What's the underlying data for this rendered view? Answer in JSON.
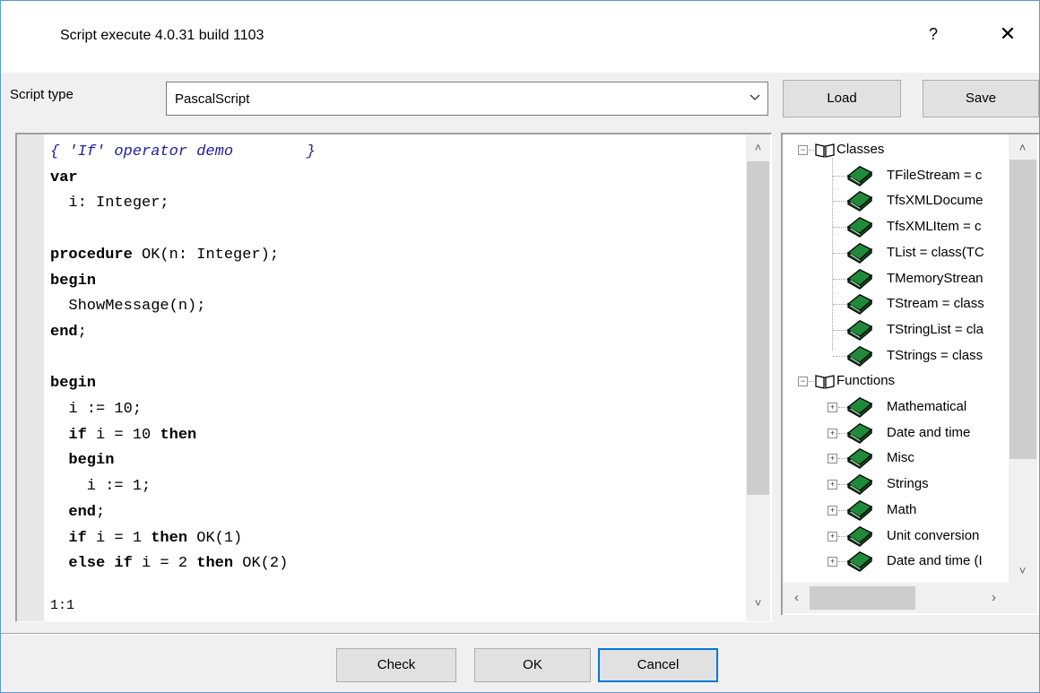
{
  "window": {
    "title": "Script execute 4.0.31 build 1103",
    "help_label": "?",
    "close_label": "✕"
  },
  "toolbar": {
    "script_type_label": "Script type",
    "script_type_value": "PascalScript",
    "load_label": "Load",
    "save_label": "Save"
  },
  "editor": {
    "lines": [
      "{ 'If' operator demo        }",
      "var",
      "  i: Integer;",
      "",
      "procedure OK(n: Integer);",
      "begin",
      "  ShowMessage(n);",
      "end;",
      "",
      "begin",
      "  i := 10;",
      "  if i = 10 then",
      "  begin",
      "    i := 1;",
      "  end;",
      "  if i = 1 then OK(1)",
      "  else if i = 2 then OK(2)"
    ],
    "cursor_position": "1:1"
  },
  "tree": {
    "groups": [
      {
        "label": "Classes",
        "expanded": true,
        "items": [
          "TFileStream = c",
          "TfsXMLDocume",
          "TfsXMLItem = c",
          "TList = class(TC",
          "TMemoryStrean",
          "TStream = class",
          "TStringList = cla",
          "TStrings = class"
        ]
      },
      {
        "label": "Functions",
        "expanded": true,
        "items": [
          "Mathematical",
          "Date and time",
          "Misc",
          "Strings",
          "Math",
          "Unit conversion",
          "Date and time (I"
        ]
      }
    ],
    "icons": {
      "group": "open-book-icon",
      "item": "green-book-icon"
    }
  },
  "footer": {
    "check_label": "Check",
    "ok_label": "OK",
    "cancel_label": "Cancel"
  },
  "colors": {
    "accent": "#0078d7",
    "comment": "#2020a0",
    "book_green": "#1f8a3a"
  }
}
